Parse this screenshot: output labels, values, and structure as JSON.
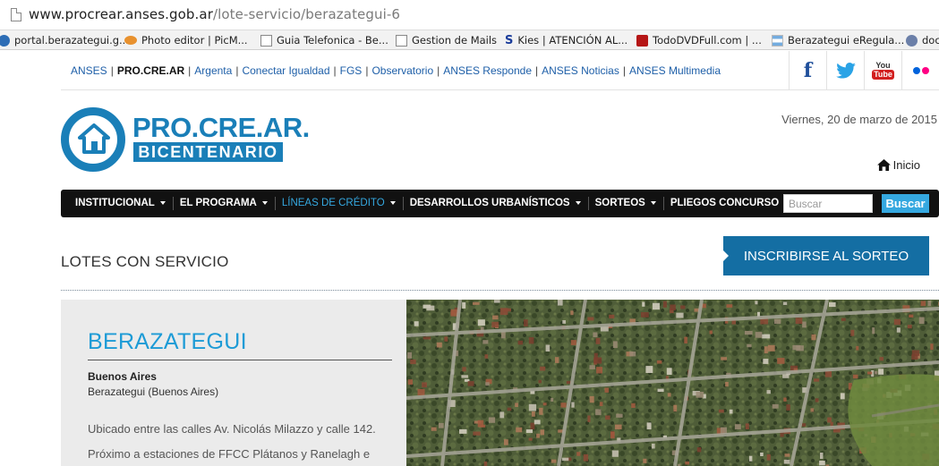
{
  "browser": {
    "url_host": "www.procrear.anses.gob.ar",
    "url_path": "/lote-servicio/berazategui-6"
  },
  "bookmarks": [
    {
      "label": "portal.berazategui.g...",
      "icon": "globe-icon"
    },
    {
      "label": "Photo editor | PicM...",
      "icon": "eye-icon"
    },
    {
      "label": "Guia Telefonica - Be...",
      "icon": "page-icon"
    },
    {
      "label": "Gestion de Mails",
      "icon": "page-icon"
    },
    {
      "label": "Kies | ATENCIÓN AL...",
      "icon": "s-icon"
    },
    {
      "label": "TodoDVDFull.com | ...",
      "icon": "dvd-icon"
    },
    {
      "label": "Berazategui eRegula...",
      "icon": "flag-icon"
    },
    {
      "label": "doc",
      "icon": "gear-icon"
    }
  ],
  "toplinks": {
    "items": [
      {
        "label": "ANSES",
        "style": "link"
      },
      {
        "label": "PRO.CRE.AR",
        "style": "strong"
      },
      {
        "label": "Argenta",
        "style": "link"
      },
      {
        "label": "Conectar Igualdad",
        "style": "link"
      },
      {
        "label": "FGS",
        "style": "link"
      },
      {
        "label": "Observatorio",
        "style": "link"
      },
      {
        "label": "ANSES Responde",
        "style": "link"
      },
      {
        "label": "ANSES Noticias",
        "style": "link"
      },
      {
        "label": "ANSES Multimedia",
        "style": "link"
      }
    ],
    "separator": "|"
  },
  "social": {
    "facebook": "f",
    "youtube_top": "You",
    "youtube_bottom": "Tube"
  },
  "logo": {
    "line1": "PRO.CRE.AR.",
    "line2": "BICENTENARIO"
  },
  "header": {
    "date": "Viernes, 20 de marzo de 2015",
    "home_link": "Inicio"
  },
  "nav": {
    "items": [
      {
        "label": "INSTITUCIONAL",
        "active": false
      },
      {
        "label": "EL PROGRAMA",
        "active": false
      },
      {
        "label": "LÍNEAS DE CRÉDITO",
        "active": true
      },
      {
        "label": "DESARROLLOS URBANÍSTICOS",
        "active": false
      },
      {
        "label": "SORTEOS",
        "active": false
      },
      {
        "label": "PLIEGOS CONCURSO",
        "active": false
      }
    ],
    "search_placeholder": "Buscar",
    "search_button": "Buscar"
  },
  "section": {
    "title": "LOTES CON SERVICIO",
    "cta": "INSCRIBIRSE AL SORTEO"
  },
  "content": {
    "place": "BERAZATEGUI",
    "province": "Buenos Aires",
    "locality": "Berazategui (Buenos Aires)",
    "para1": "Ubicado entre las calles Av. Nicolás Milazzo y calle 142.",
    "para2": "Próximo a estaciones de FFCC Plátanos y Ranelagh e"
  },
  "colors": {
    "brand_blue": "#1a7fb8",
    "accent_blue": "#35a8e0",
    "cta_blue": "#146ea3",
    "navbar": "#111111"
  }
}
